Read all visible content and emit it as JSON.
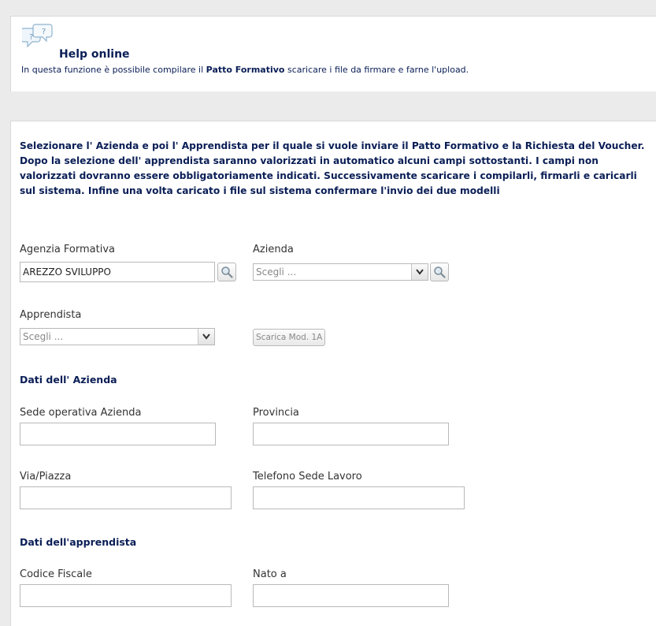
{
  "help": {
    "title": "Help online",
    "desc_prefix": "In questa funzione è possibile compilare il ",
    "desc_bold": "Patto Formativo",
    "desc_suffix": " scaricare i file da firmare e farne l'upload."
  },
  "form": {
    "intro": "Selezionare l' Azienda e poi l' Apprendista per il quale si vuole inviare il Patto Formativo e la Richiesta del Voucher. Dopo la selezione dell' apprendista saranno valorizzati in automatico alcuni campi sottostanti. I campi non valorizzati dovranno essere obbligatoriamente indicati. Successivamente scaricare i compilarli, firmarli e caricarli sul sistema. Infine una volta caricato i file sul sistema confermare l'invio dei due modelli",
    "agenzia_label": "Agenzia Formativa",
    "agenzia_value": "AREZZO SVILUPPO",
    "azienda_label": "Azienda",
    "azienda_value": "Scegli ...",
    "apprendista_label": "Apprendista",
    "apprendista_value": "Scegli ...",
    "scarica_label": "Scarica Mod. 1A",
    "section_azienda": "Dati dell' Azienda",
    "sede_label": "Sede operativa Azienda",
    "sede_value": "",
    "provincia_label": "Provincia",
    "provincia_value": "",
    "via_label": "Via/Piazza",
    "via_value": "",
    "telefono_label": "Telefono Sede Lavoro",
    "telefono_value": "",
    "section_apprendista": "Dati dell'apprendista",
    "cf_label": "Codice Fiscale",
    "cf_value": "",
    "nato_label": "Nato a",
    "nato_value": ""
  },
  "icons": {
    "help": "help-chat-icon",
    "search": "magnifier-icon",
    "dropdown": "chevron-down-icon"
  },
  "colors": {
    "heading": "#0a1e56",
    "background": "#ebebeb",
    "panel": "#ffffff"
  }
}
